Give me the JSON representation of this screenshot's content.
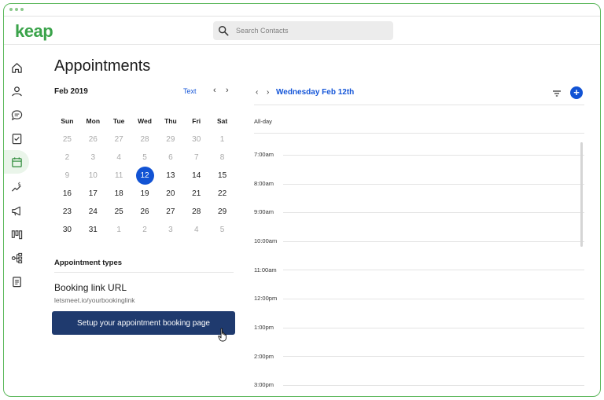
{
  "app": {
    "logo": "keap"
  },
  "search": {
    "placeholder": "Search Contacts"
  },
  "sidebar": {
    "items": [
      {
        "icon": "home-icon"
      },
      {
        "icon": "person-icon"
      },
      {
        "icon": "chat-icon"
      },
      {
        "icon": "tasks-icon"
      },
      {
        "icon": "calendar-icon",
        "active": true
      },
      {
        "icon": "money-icon"
      },
      {
        "icon": "megaphone-icon"
      },
      {
        "icon": "pipeline-icon"
      },
      {
        "icon": "automation-icon"
      },
      {
        "icon": "reports-icon"
      }
    ]
  },
  "page": {
    "title": "Appointments"
  },
  "calendar": {
    "month": "Feb 2019",
    "text_link": "Text",
    "prev": "‹",
    "next": "›",
    "weekdays": [
      "Sun",
      "Mon",
      "Tue",
      "Wed",
      "Thu",
      "Fri",
      "Sat"
    ],
    "weeks": [
      [
        "25",
        "26",
        "27",
        "28",
        "29",
        "30",
        "1"
      ],
      [
        "2",
        "3",
        "4",
        "5",
        "6",
        "7",
        "8"
      ],
      [
        "9",
        "10",
        "11",
        "12",
        "13",
        "14",
        "15"
      ],
      [
        "16",
        "17",
        "18",
        "19",
        "20",
        "21",
        "22"
      ],
      [
        "23",
        "24",
        "25",
        "26",
        "27",
        "28",
        "29"
      ],
      [
        "30",
        "31",
        "1",
        "2",
        "3",
        "4",
        "5"
      ]
    ],
    "selected": "12"
  },
  "appointment_types": {
    "label": "Appointment types",
    "booking_label": "Booking link URL",
    "booking_url": "letsmeet.io/yourbookinglink",
    "setup_button": "Setup your appointment booking page"
  },
  "day_view": {
    "prev": "‹",
    "next": "›",
    "title": "Wednesday Feb 12th",
    "add": "+",
    "all_day": "All-day",
    "times": [
      "7:00am",
      "8:00am",
      "9:00am",
      "10:00am",
      "11:00am",
      "12:00pm",
      "1:00pm",
      "2:00pm",
      "3:00pm"
    ]
  },
  "colors": {
    "accent": "#1253d4",
    "brand": "#3aa34a",
    "button": "#1f3a6e",
    "border": "#5cb85c"
  }
}
